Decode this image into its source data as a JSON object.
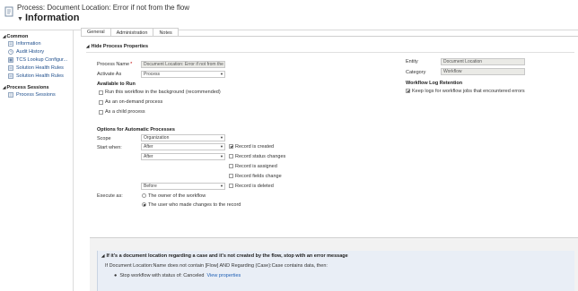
{
  "header": {
    "process_title": "Process: Document Location: Error if not from the flow",
    "page_title": "Information"
  },
  "sidebar": {
    "groups": [
      {
        "label": "Common",
        "items": [
          {
            "label": "Information",
            "icon": "info-icon"
          },
          {
            "label": "Audit History",
            "icon": "history-icon"
          },
          {
            "label": "TCS Lookup Configur...",
            "icon": "lookup-icon"
          },
          {
            "label": "Solution Health Rules",
            "icon": "rules-icon"
          },
          {
            "label": "Solution Health Rules",
            "icon": "rules-icon"
          }
        ]
      },
      {
        "label": "Process Sessions",
        "items": [
          {
            "label": "Process Sessions",
            "icon": "sessions-icon"
          }
        ]
      }
    ]
  },
  "tabs": [
    "General",
    "Administration",
    "Notes"
  ],
  "section": {
    "title": "Hide Process Properties",
    "process_name_label": "Process Name",
    "process_name_value": "Document Location: Error if not from the",
    "activate_as_label": "Activate As",
    "activate_as_value": "Process",
    "available_heading": "Available to Run",
    "available_options": [
      "Run this workflow in the background (recommended)",
      "As an on-demand process",
      "As a child process"
    ],
    "entity_label": "Entity",
    "entity_value": "Document Location",
    "category_label": "Category",
    "category_value": "Workflow",
    "retention_heading": "Workflow Log Retention",
    "retention_option": "Keep logs for workflow jobs that encountered errors"
  },
  "automatic": {
    "heading": "Options for Automatic Processes",
    "scope_label": "Scope",
    "scope_value": "Organization",
    "start_when_label": "Start when:",
    "start_selects": [
      "After",
      "After",
      "Before"
    ],
    "triggers": [
      {
        "label": "Record is created",
        "checked": true
      },
      {
        "label": "Record status changes",
        "checked": false
      },
      {
        "label": "Record is assigned",
        "checked": false
      },
      {
        "label": "Record fields change",
        "checked": false
      },
      {
        "label": "Record is deleted",
        "checked": false
      }
    ],
    "execute_as_label": "Execute as:",
    "execute_options": [
      {
        "label": "The owner of the workflow",
        "selected": false
      },
      {
        "label": "The user who made changes to the record",
        "selected": true
      }
    ]
  },
  "step": {
    "title": "If it's a document location regarding a case and it's not created by the flow, stop with an error message",
    "condition": "If Document Location:Name does not contain [Flow] AND Regarding (Case):Case contains data, then:",
    "action": "Stop workflow with status of:  Canceled",
    "action_link": "View properties"
  }
}
